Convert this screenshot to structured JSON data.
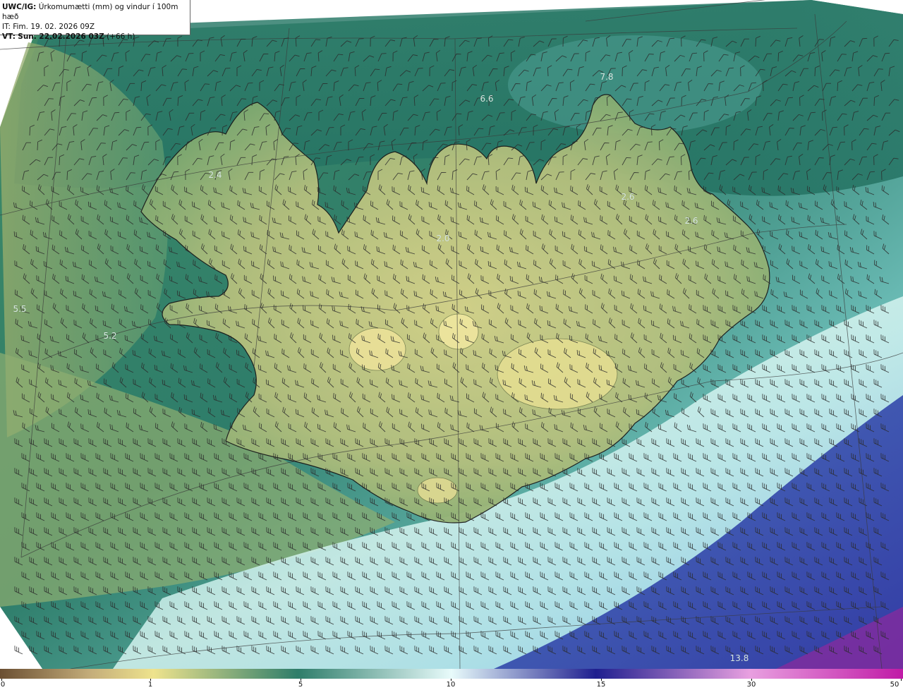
{
  "header": {
    "model": "UWC/IG:",
    "title": "Úrkomumætti (mm) og vindur í 100m hæð",
    "init_time": "IT: Fim. 19. 02. 2026 09Z",
    "valid_label": "VT:",
    "valid_time": "Sun. 22.02.2026 03Z",
    "lead": "(+66 h)"
  },
  "value_labels": [
    {
      "text": "7.8"
    },
    {
      "text": "6.6"
    },
    {
      "text": "2.4"
    },
    {
      "text": "2.0"
    },
    {
      "text": "2.6"
    },
    {
      "text": "2.6"
    },
    {
      "text": "5.5"
    },
    {
      "text": "5.2"
    },
    {
      "text": "13.8"
    }
  ],
  "colorbar": {
    "ticks": [
      "0",
      "1",
      "5",
      "10",
      "15",
      "30",
      "50"
    ],
    "colors": [
      "#6b4f32",
      "#c4ad7a",
      "#eee38d",
      "#2e7d6a",
      "#e8fbfb",
      "#1f1f8f",
      "#e8a0e0",
      "#c01aa6"
    ]
  }
}
